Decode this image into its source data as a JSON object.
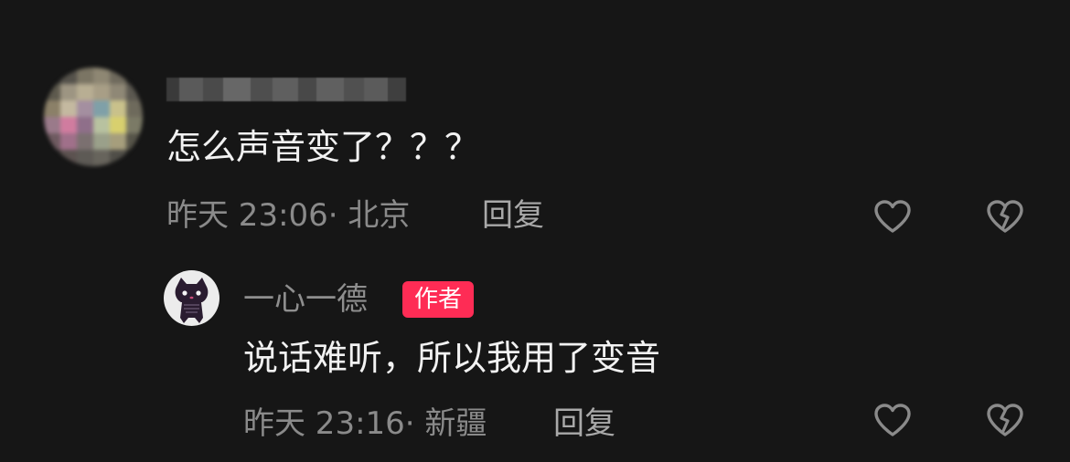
{
  "comment": {
    "text": "怎么声音变了？？？",
    "time": "昨天 23:06",
    "location_sep": "· 北京",
    "reply_label": "回复"
  },
  "reply": {
    "username": "一心一德",
    "badge": "作者",
    "text": "说话难听，所以我用了变音",
    "time": "昨天 23:16",
    "location_sep": "· 新疆",
    "reply_label": "回复"
  },
  "icons": {
    "like": "heart-outline-icon",
    "dislike": "broken-heart-icon"
  },
  "colors": {
    "background": "#161616",
    "badge": "#fe2c55",
    "icon_stroke": "#8a8a8a"
  }
}
